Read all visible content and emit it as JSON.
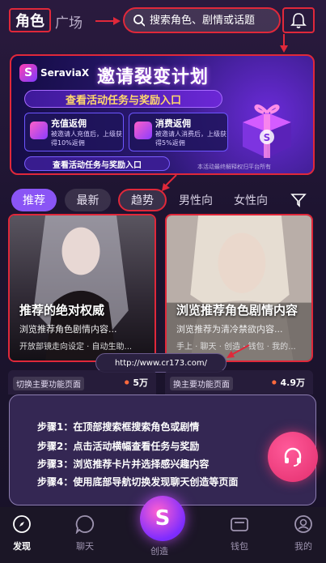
{
  "header": {
    "tab_role": "角色",
    "tab_square": "广场",
    "search_placeholder": "搜索角色、剧情或话题"
  },
  "banner": {
    "logo_text": "SeraviaX",
    "title": "邀请裂变计划",
    "subtitle": "查看活动任务与奖励入口",
    "card1_title": "充值返佣",
    "card1_desc": "被邀请人充值后，上级获得10%返佣",
    "card2_title": "消费返佣",
    "card2_desc": "被邀请人消费后，上级获得5%返佣",
    "cta": "查看活动任务与奖励入口",
    "note": "本活动最终解释权归平台所有"
  },
  "filters": [
    "推荐",
    "最新",
    "趋势",
    "男性向",
    "女性向"
  ],
  "cards": [
    {
      "name": "推荐的绝对权威",
      "desc": "浏览推荐角色剧情内容...",
      "tags": "开放部镜走向设定 · 自动生助..."
    },
    {
      "name": "浏览推荐角色剧情内容",
      "desc": "浏览推荐为清冷禁欲内容...",
      "tags": "手上 · 聊天 · 创造 · 钱包 · 我的..."
    }
  ],
  "url_chip": "http://www.cr173.com/",
  "row2": [
    {
      "label": "切换主要功能页面",
      "count": "5万"
    },
    {
      "label": "换主要功能页面",
      "count": "4.9万"
    }
  ],
  "guide_steps": [
    "步骤1：在顶部搜索框搜索角色或剧情",
    "步骤2：点击活动横幅查看任务与奖励",
    "步骤3：浏览推荐卡片并选择感兴趣内容",
    "步骤4：使用底部导航切换发现聊天创造等页面"
  ],
  "nav": {
    "discover": "发现",
    "chat": "聊天",
    "create": "创造",
    "wallet": "钱包",
    "mine": "我的"
  },
  "colors": {
    "annotation_red": "#e0283a",
    "accent_purple": "#8a55f5",
    "fab_pink": "#e32e6d"
  }
}
